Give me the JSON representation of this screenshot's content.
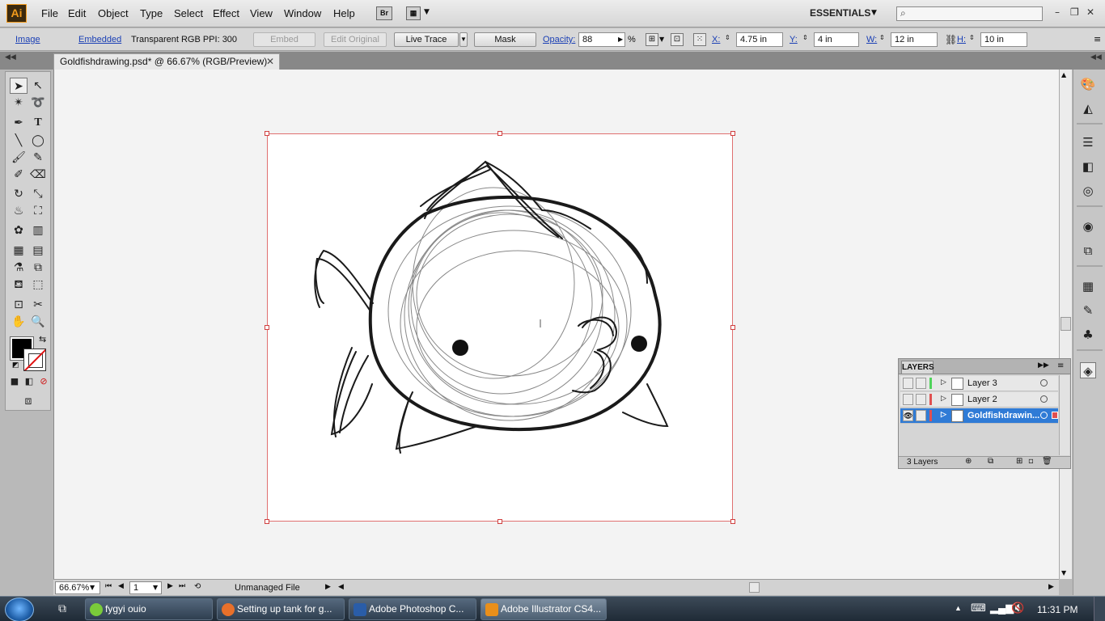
{
  "app": {
    "logo": "Ai",
    "menus": [
      "File",
      "Edit",
      "Object",
      "Type",
      "Select",
      "Effect",
      "View",
      "Window",
      "Help"
    ],
    "bridge_label": "Br",
    "workspace": "ESSENTIALS",
    "search_placeholder": "",
    "window_buttons": [
      "–",
      "❐",
      "✕"
    ]
  },
  "control_bar": {
    "type_label": "Image",
    "status_label": "Embedded",
    "info": "Transparent RGB  PPI: 300",
    "embed_btn": "Embed",
    "edit_original_btn": "Edit Original",
    "live_trace_btn": "Live Trace",
    "mask_btn": "Mask",
    "opacity_label": "Opacity:",
    "opacity_value": "88",
    "opacity_unit": "%",
    "x_label": "X:",
    "x_value": "4.75 in",
    "y_label": "Y:",
    "y_value": "4 in",
    "w_label": "W:",
    "w_value": "12 in",
    "h_label": "H:",
    "h_value": "10 in"
  },
  "document": {
    "tab_title": "Goldfishdrawing.psd* @ 66.67% (RGB/Preview)",
    "close": "✕"
  },
  "status_bar": {
    "zoom": "66.67%",
    "artboard_number": "1",
    "status_text": "Unmanaged File"
  },
  "layers_panel": {
    "title": "LAYERS",
    "layers": [
      {
        "name": "Layer 3",
        "color": "#4fd35a"
      },
      {
        "name": "Layer 2",
        "color": "#e05050"
      },
      {
        "name": "Goldfishdrawin...",
        "color": "#e05050"
      }
    ],
    "count": "3 Layers"
  },
  "taskbar": {
    "tasks": [
      {
        "label": "fygyi ouio",
        "color": "#7acb3a"
      },
      {
        "label": "Setting up tank for g...",
        "color": "#e8702a"
      },
      {
        "label": "Adobe Photoshop C...",
        "color": "#2a5da8"
      },
      {
        "label": "Adobe Illustrator CS4...",
        "color": "#e98f1a"
      }
    ],
    "clock": "11:31 PM"
  }
}
